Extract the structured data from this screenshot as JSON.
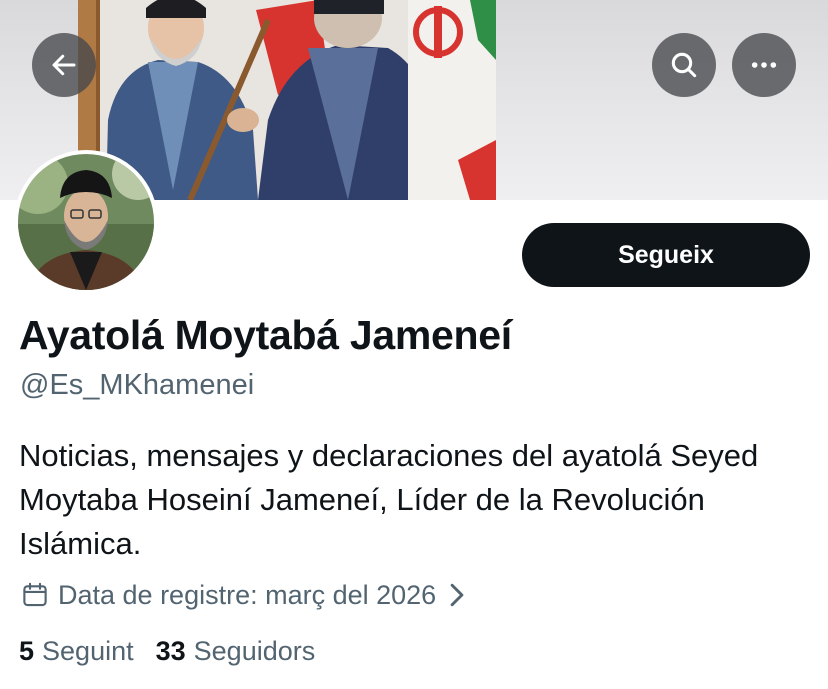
{
  "header": {
    "back_icon": "arrow-left-icon",
    "search_icon": "search-icon",
    "more_icon": "more-horizontal-icon"
  },
  "profile": {
    "display_name": "Ayatolá Moytabá Jameneí",
    "handle": "@Es_MKhamenei",
    "follow_label": "Segueix",
    "bio": "Noticias, mensajes y declaraciones del ayatolá Seyed Moytaba Hoseiní Jameneí, Líder de la Revolución Islámica.",
    "joined": "Data de registre: març del 2026",
    "following_count": "5",
    "following_label": "Seguint",
    "followers_count": "33",
    "followers_label": "Seguidors"
  },
  "colors": {
    "text_primary": "#0f1419",
    "text_secondary": "#536471",
    "button_bg": "#0f1419",
    "overlay_button": "#46484c"
  }
}
